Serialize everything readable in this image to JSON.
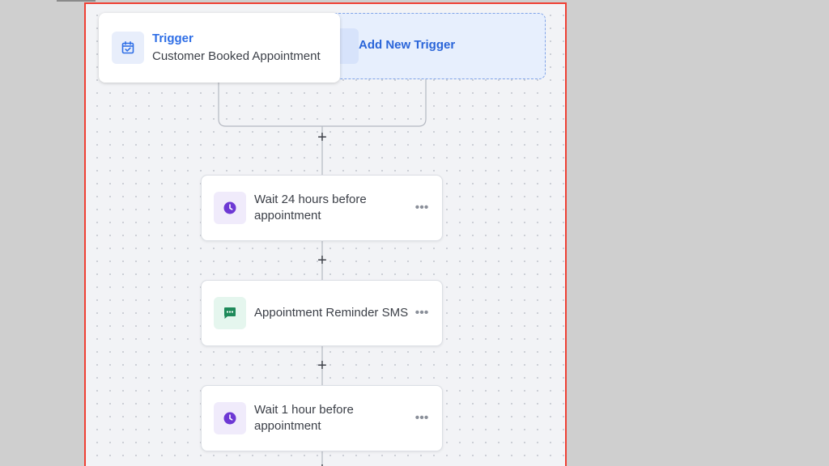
{
  "trigger": {
    "title": "Trigger",
    "event": "Customer Booked Appointment",
    "icon": "calendar-check-icon"
  },
  "add_trigger": {
    "label": "Add New Trigger"
  },
  "add_step_symbol": "+",
  "steps": [
    {
      "label": "Wait 24 hours before appointment",
      "icon": "clock-icon",
      "more": "•••"
    },
    {
      "label": "Appointment Reminder SMS",
      "icon": "chat-message-icon",
      "more": "•••"
    },
    {
      "label": "Wait 1 hour before appointment",
      "icon": "clock-icon",
      "more": "•••"
    }
  ],
  "colors": {
    "accent_blue": "#2e6ee6",
    "wait_purple": "#6d38d4",
    "sms_green": "#1e8a5a",
    "highlight_red": "#ef4034"
  }
}
